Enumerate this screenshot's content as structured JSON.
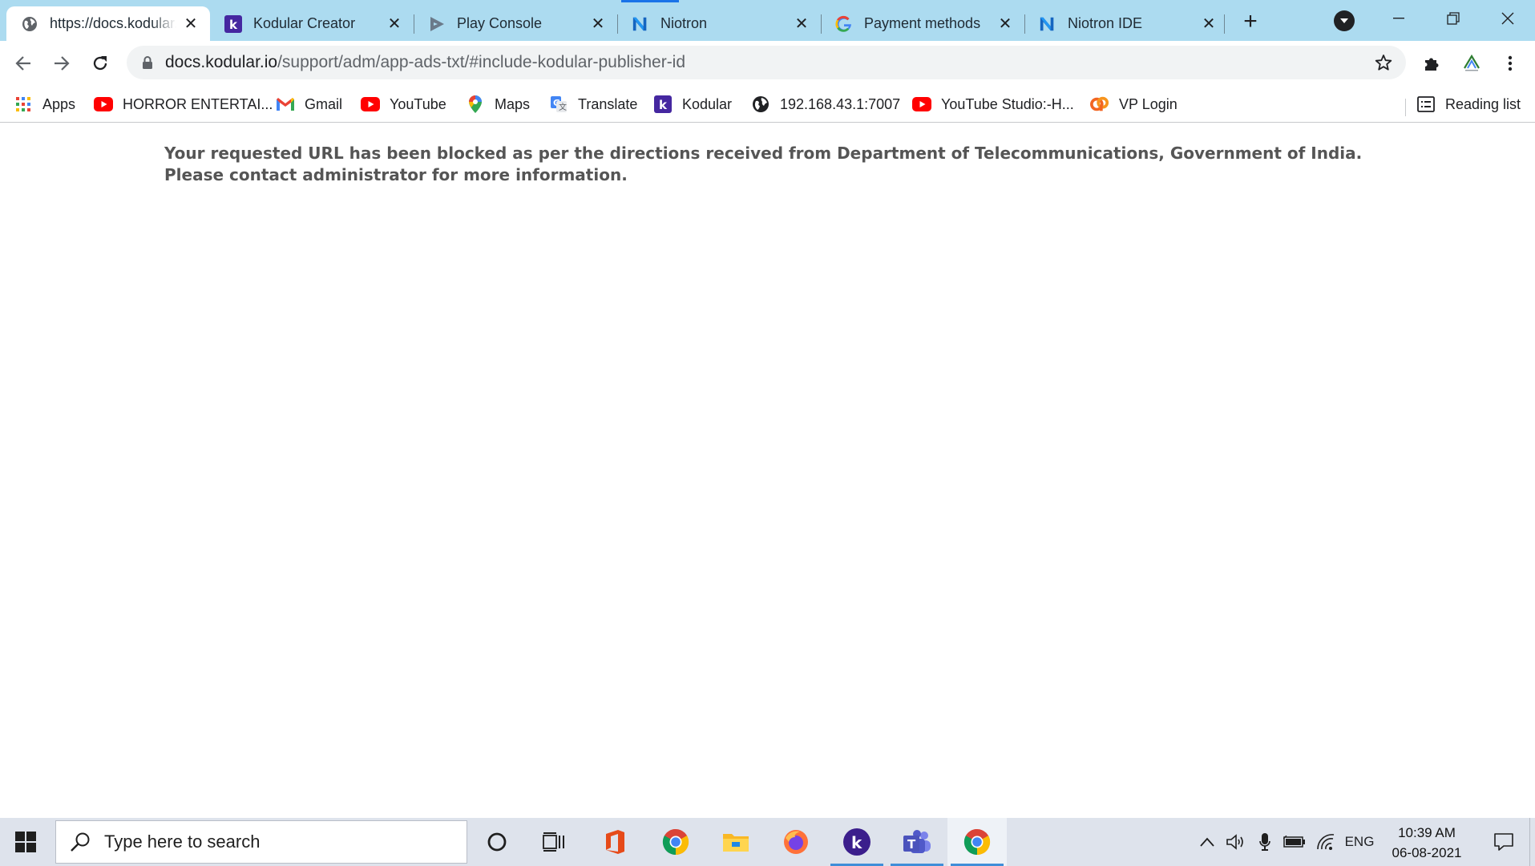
{
  "browser": {
    "tabs": [
      {
        "title": "https://docs.kodular.io/support/adm/app-ads-txt/",
        "favicon": "globe-icon",
        "active": true
      },
      {
        "title": "Kodular Creator",
        "favicon": "kodular-icon",
        "active": false
      },
      {
        "title": "Play Console",
        "favicon": "play-console-icon",
        "active": false
      },
      {
        "title": "Niotron",
        "favicon": "niotron-icon",
        "active": false
      },
      {
        "title": "Payment methods",
        "favicon": "google-g-icon",
        "active": false
      },
      {
        "title": "Niotron IDE",
        "favicon": "niotron-icon",
        "active": false
      }
    ],
    "new_tab_symbol": "+",
    "address": {
      "host": "docs.kodular.io",
      "path": "/support/adm/app-ads-txt/#include-kodular-publisher-id"
    },
    "bookmarks": [
      {
        "label": "Apps",
        "icon": "apps-grid-icon"
      },
      {
        "label": "HORROR ENTERTAI...",
        "icon": "youtube-icon"
      },
      {
        "label": "Gmail",
        "icon": "gmail-icon"
      },
      {
        "label": "YouTube",
        "icon": "youtube-icon"
      },
      {
        "label": "Maps",
        "icon": "maps-pin-icon"
      },
      {
        "label": "Translate",
        "icon": "translate-icon"
      },
      {
        "label": "Kodular",
        "icon": "kodular-icon"
      },
      {
        "label": "192.168.43.1:7007",
        "icon": "globe-icon"
      },
      {
        "label": "YouTube Studio:-H...",
        "icon": "youtube-icon"
      },
      {
        "label": "VP Login",
        "icon": "vp-icon"
      }
    ],
    "reading_list_label": "Reading list"
  },
  "page": {
    "message": "Your requested URL has been blocked as per the directions received from Department of Telecommunications, Government of India. Please contact administrator for more information."
  },
  "taskbar": {
    "search_placeholder": "Type here to search",
    "language": "ENG",
    "time": "10:39 AM",
    "date": "06-08-2021"
  },
  "colors": {
    "tabstrip": "#acdbf0",
    "omnibox": "#f1f3f4",
    "taskbar": "#dee3ec",
    "message_text": "#555555",
    "kodular_purple": "#4527a0",
    "youtube_red": "#ff0000"
  }
}
